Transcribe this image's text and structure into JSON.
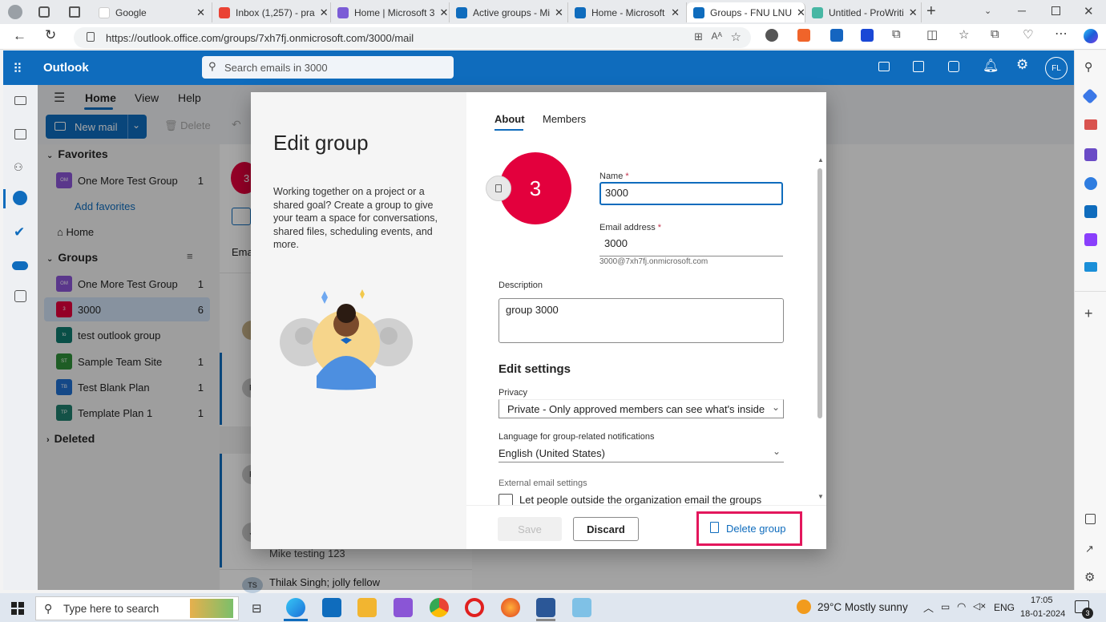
{
  "browser": {
    "tabs": [
      {
        "label": "Google",
        "color": "#ffffff"
      },
      {
        "label": "Inbox (1,257) - pra",
        "color": "#ea4335"
      },
      {
        "label": "Home | Microsoft 3",
        "color": "#7b5cd6"
      },
      {
        "label": "Active groups - Mi",
        "color": "#0f6cbd"
      },
      {
        "label": "Home - Microsoft",
        "color": "#0f6cbd"
      },
      {
        "label": "Groups - FNU LNU",
        "color": "#0f6cbd"
      },
      {
        "label": "Untitled - ProWriti",
        "color": "#47b7a4"
      }
    ],
    "url": "https://outlook.office.com/groups/7xh7fj.onmicrosoft.com/3000/mail"
  },
  "outlook": {
    "app_name": "Outlook",
    "search_placeholder": "Search emails in 3000",
    "avatar_initials": "FL",
    "ribbon_tabs": [
      "Home",
      "View",
      "Help"
    ],
    "new_mail": "New mail",
    "delete": "Delete"
  },
  "folders": {
    "favorites_label": "Favorites",
    "favorites": [
      {
        "label": "One More Test Group",
        "count": "1",
        "initials": "OM",
        "color": "#8a55d6"
      }
    ],
    "add_favorites": "Add favorites",
    "home": "Home",
    "groups_label": "Groups",
    "groups": [
      {
        "label": "One More Test Group",
        "count": "1",
        "initials": "OM",
        "color": "#8a55d6"
      },
      {
        "label": "3000",
        "count": "6",
        "initials": "3",
        "color": "#e3003d"
      },
      {
        "label": "test outlook group",
        "count": "",
        "initials": "to",
        "color": "#0e7a6e"
      },
      {
        "label": "Sample Team Site",
        "count": "1",
        "initials": "ST",
        "color": "#2f8f3a"
      },
      {
        "label": "Test Blank Plan",
        "count": "1",
        "initials": "TB",
        "color": "#1f6fcf"
      },
      {
        "label": "Template Plan 1",
        "count": "1",
        "initials": "TP",
        "color": "#1f7f6e"
      }
    ],
    "deleted": "Deleted"
  },
  "maillist": {
    "tab_partial": "Ema",
    "preview": "Mike testing 123",
    "from": "Thilak Singh; jolly fellow",
    "avatar_initials": [
      "3",
      "F",
      "F",
      "J",
      "TS"
    ]
  },
  "modal": {
    "title": "Edit group",
    "description": "Working together on a project or a shared goal? Create a group to give your team a space for conversations, shared files, scheduling events, and more.",
    "tabs": [
      "About",
      "Members"
    ],
    "group_avatar": "3",
    "name_label": "Name",
    "required": "*",
    "name_value": "3000",
    "email_label": "Email address",
    "email_value": "3000",
    "email_full": "3000@7xh7fj.onmicrosoft.com",
    "description_label": "Description",
    "description_value": "group 3000",
    "settings_heading": "Edit settings",
    "privacy_label": "Privacy",
    "privacy_value": "Private - Only approved members can see what's inside",
    "language_label": "Language for group-related notifications",
    "language_value": "English (United States)",
    "external_label": "External email settings",
    "external_checkbox": "Let people outside the organization email the groups",
    "save": "Save",
    "discard": "Discard",
    "delete_group": "Delete group"
  },
  "taskbar": {
    "search_placeholder": "Type here to search",
    "weather": "29°C  Mostly sunny",
    "lang": "ENG",
    "time": "17:05",
    "date": "18-01-2024",
    "notif_count": "3"
  }
}
